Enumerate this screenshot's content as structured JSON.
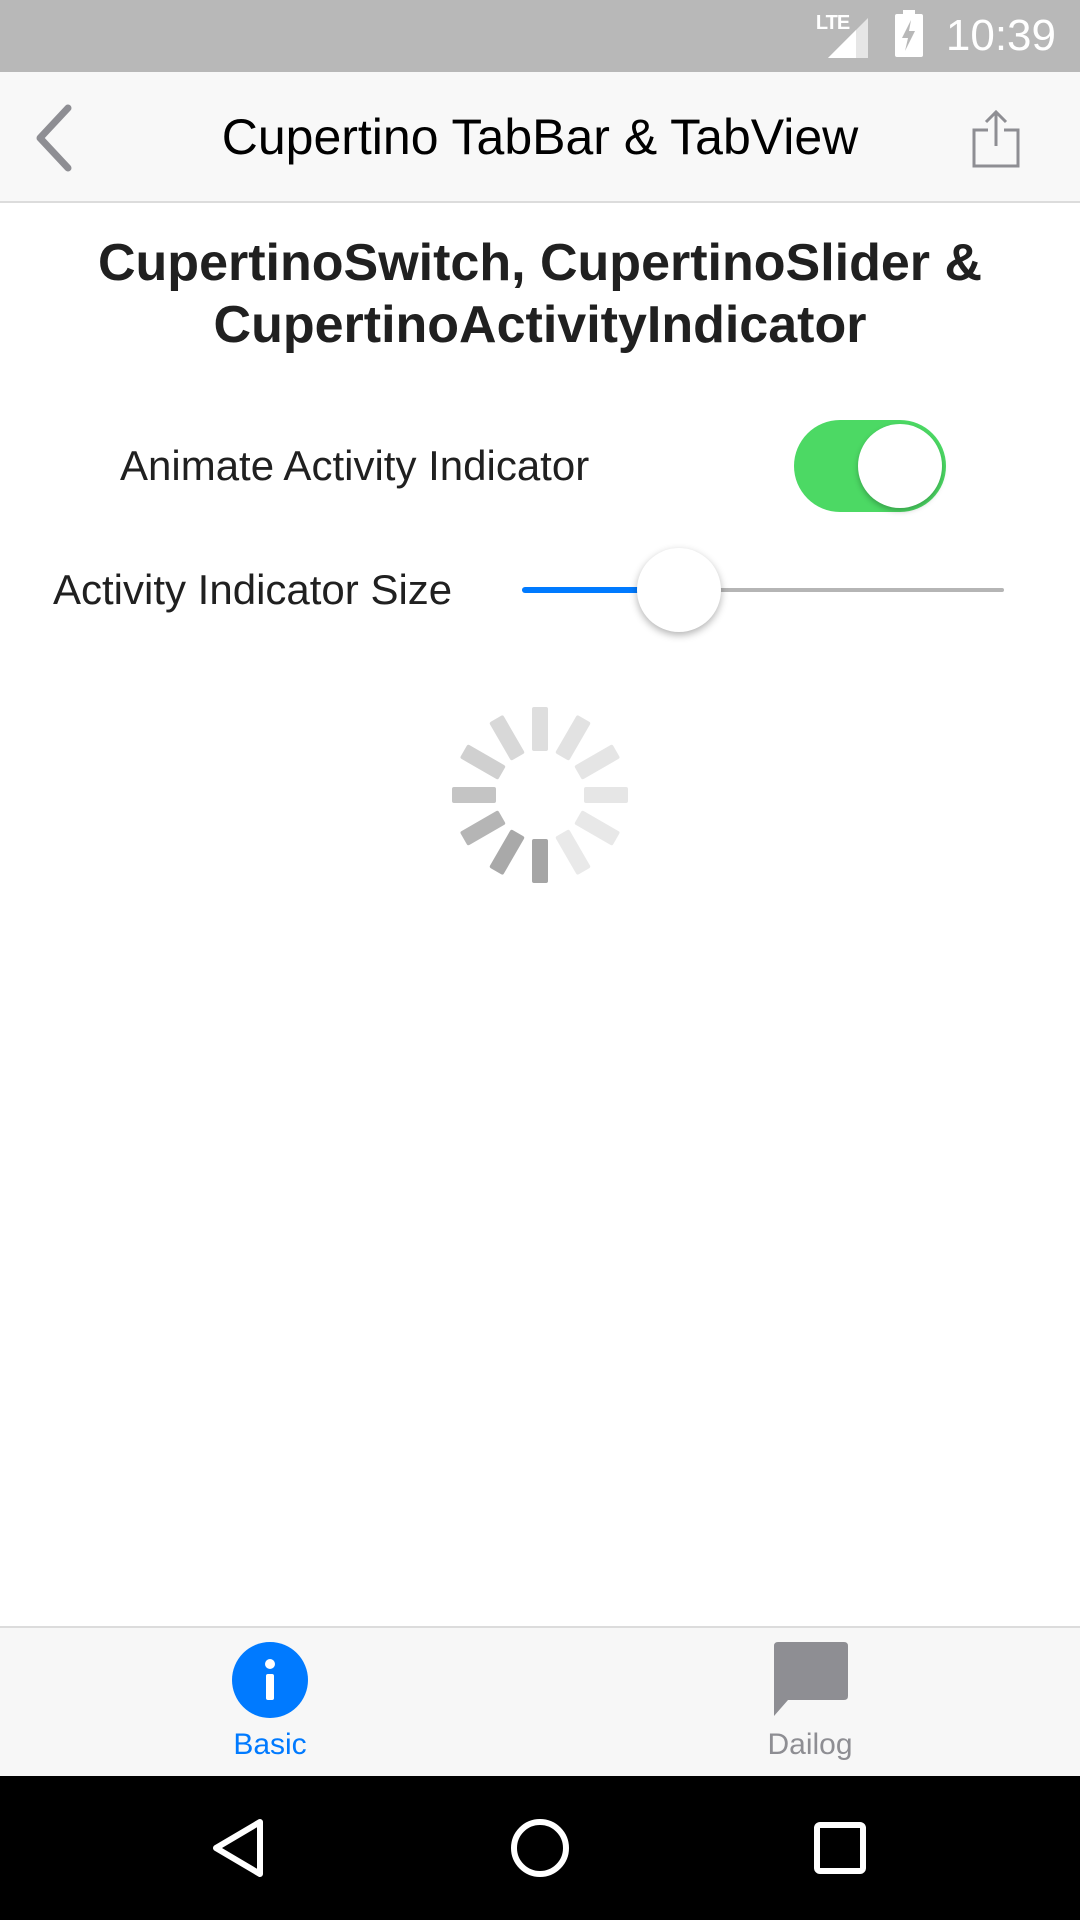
{
  "status_bar": {
    "time": "10:39",
    "network": "LTE",
    "background_color": "#b8b8b8"
  },
  "app_bar": {
    "title": "Cupertino TabBar & TabView",
    "back_icon": "chevron-left-icon",
    "share_icon": "share-icon"
  },
  "content": {
    "section_title": "CupertinoSwitch, CupertinoSlider & CupertinoActivityIndicator",
    "switch": {
      "label": "Animate Activity Indicator",
      "on": true,
      "color": "#4cd964"
    },
    "slider": {
      "label": "Activity Indicator Size",
      "value_fraction": 0.325,
      "active_color": "#007aff"
    },
    "activity_indicator": {
      "animating": true
    }
  },
  "tab_bar": {
    "tabs": [
      {
        "label": "Basic",
        "icon": "info-icon",
        "active": true
      },
      {
        "label": "Dailog",
        "icon": "chat-bubble-icon",
        "active": false
      }
    ],
    "active_color": "#007aff",
    "inactive_color": "#8e8e93"
  },
  "nav_bar": {
    "buttons": [
      "back-triangle-icon",
      "home-circle-icon",
      "recents-square-icon"
    ]
  }
}
